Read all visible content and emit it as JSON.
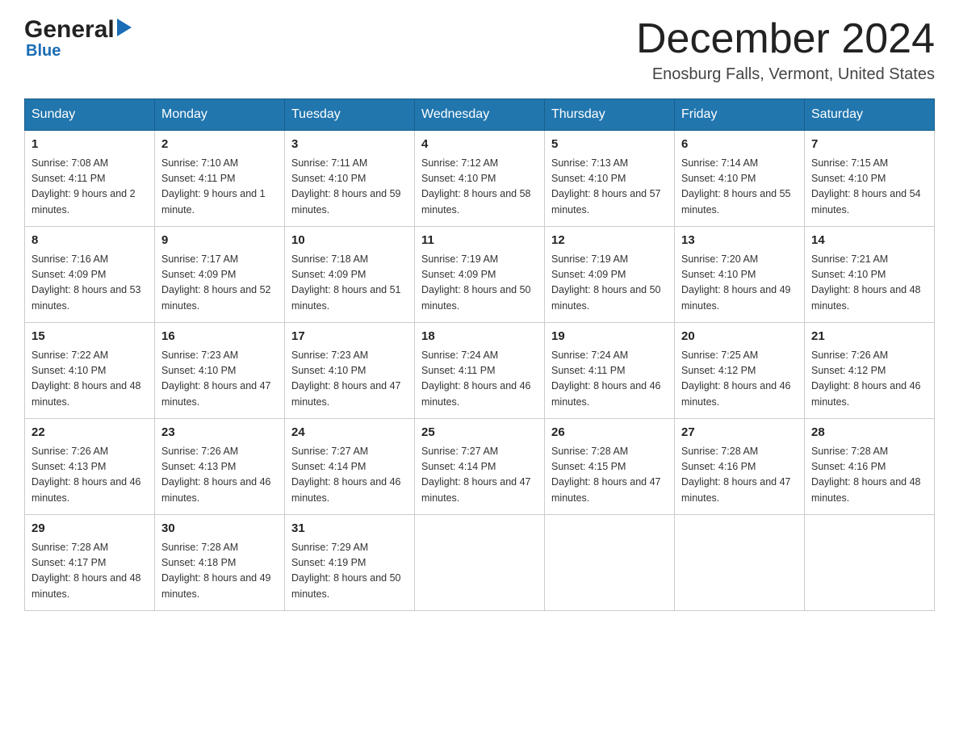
{
  "header": {
    "logo": {
      "general": "General",
      "triangle_symbol": "▶",
      "blue": "Blue"
    },
    "title": "December 2024",
    "location": "Enosburg Falls, Vermont, United States"
  },
  "calendar": {
    "days_of_week": [
      "Sunday",
      "Monday",
      "Tuesday",
      "Wednesday",
      "Thursday",
      "Friday",
      "Saturday"
    ],
    "weeks": [
      [
        {
          "day": "1",
          "sunrise": "7:08 AM",
          "sunset": "4:11 PM",
          "daylight": "9 hours and 2 minutes."
        },
        {
          "day": "2",
          "sunrise": "7:10 AM",
          "sunset": "4:11 PM",
          "daylight": "9 hours and 1 minute."
        },
        {
          "day": "3",
          "sunrise": "7:11 AM",
          "sunset": "4:10 PM",
          "daylight": "8 hours and 59 minutes."
        },
        {
          "day": "4",
          "sunrise": "7:12 AM",
          "sunset": "4:10 PM",
          "daylight": "8 hours and 58 minutes."
        },
        {
          "day": "5",
          "sunrise": "7:13 AM",
          "sunset": "4:10 PM",
          "daylight": "8 hours and 57 minutes."
        },
        {
          "day": "6",
          "sunrise": "7:14 AM",
          "sunset": "4:10 PM",
          "daylight": "8 hours and 55 minutes."
        },
        {
          "day": "7",
          "sunrise": "7:15 AM",
          "sunset": "4:10 PM",
          "daylight": "8 hours and 54 minutes."
        }
      ],
      [
        {
          "day": "8",
          "sunrise": "7:16 AM",
          "sunset": "4:09 PM",
          "daylight": "8 hours and 53 minutes."
        },
        {
          "day": "9",
          "sunrise": "7:17 AM",
          "sunset": "4:09 PM",
          "daylight": "8 hours and 52 minutes."
        },
        {
          "day": "10",
          "sunrise": "7:18 AM",
          "sunset": "4:09 PM",
          "daylight": "8 hours and 51 minutes."
        },
        {
          "day": "11",
          "sunrise": "7:19 AM",
          "sunset": "4:09 PM",
          "daylight": "8 hours and 50 minutes."
        },
        {
          "day": "12",
          "sunrise": "7:19 AM",
          "sunset": "4:09 PM",
          "daylight": "8 hours and 50 minutes."
        },
        {
          "day": "13",
          "sunrise": "7:20 AM",
          "sunset": "4:10 PM",
          "daylight": "8 hours and 49 minutes."
        },
        {
          "day": "14",
          "sunrise": "7:21 AM",
          "sunset": "4:10 PM",
          "daylight": "8 hours and 48 minutes."
        }
      ],
      [
        {
          "day": "15",
          "sunrise": "7:22 AM",
          "sunset": "4:10 PM",
          "daylight": "8 hours and 48 minutes."
        },
        {
          "day": "16",
          "sunrise": "7:23 AM",
          "sunset": "4:10 PM",
          "daylight": "8 hours and 47 minutes."
        },
        {
          "day": "17",
          "sunrise": "7:23 AM",
          "sunset": "4:10 PM",
          "daylight": "8 hours and 47 minutes."
        },
        {
          "day": "18",
          "sunrise": "7:24 AM",
          "sunset": "4:11 PM",
          "daylight": "8 hours and 46 minutes."
        },
        {
          "day": "19",
          "sunrise": "7:24 AM",
          "sunset": "4:11 PM",
          "daylight": "8 hours and 46 minutes."
        },
        {
          "day": "20",
          "sunrise": "7:25 AM",
          "sunset": "4:12 PM",
          "daylight": "8 hours and 46 minutes."
        },
        {
          "day": "21",
          "sunrise": "7:26 AM",
          "sunset": "4:12 PM",
          "daylight": "8 hours and 46 minutes."
        }
      ],
      [
        {
          "day": "22",
          "sunrise": "7:26 AM",
          "sunset": "4:13 PM",
          "daylight": "8 hours and 46 minutes."
        },
        {
          "day": "23",
          "sunrise": "7:26 AM",
          "sunset": "4:13 PM",
          "daylight": "8 hours and 46 minutes."
        },
        {
          "day": "24",
          "sunrise": "7:27 AM",
          "sunset": "4:14 PM",
          "daylight": "8 hours and 46 minutes."
        },
        {
          "day": "25",
          "sunrise": "7:27 AM",
          "sunset": "4:14 PM",
          "daylight": "8 hours and 47 minutes."
        },
        {
          "day": "26",
          "sunrise": "7:28 AM",
          "sunset": "4:15 PM",
          "daylight": "8 hours and 47 minutes."
        },
        {
          "day": "27",
          "sunrise": "7:28 AM",
          "sunset": "4:16 PM",
          "daylight": "8 hours and 47 minutes."
        },
        {
          "day": "28",
          "sunrise": "7:28 AM",
          "sunset": "4:16 PM",
          "daylight": "8 hours and 48 minutes."
        }
      ],
      [
        {
          "day": "29",
          "sunrise": "7:28 AM",
          "sunset": "4:17 PM",
          "daylight": "8 hours and 48 minutes."
        },
        {
          "day": "30",
          "sunrise": "7:28 AM",
          "sunset": "4:18 PM",
          "daylight": "8 hours and 49 minutes."
        },
        {
          "day": "31",
          "sunrise": "7:29 AM",
          "sunset": "4:19 PM",
          "daylight": "8 hours and 50 minutes."
        },
        null,
        null,
        null,
        null
      ]
    ],
    "labels": {
      "sunrise_prefix": "Sunrise: ",
      "sunset_prefix": "Sunset: ",
      "daylight_prefix": "Daylight: "
    }
  }
}
